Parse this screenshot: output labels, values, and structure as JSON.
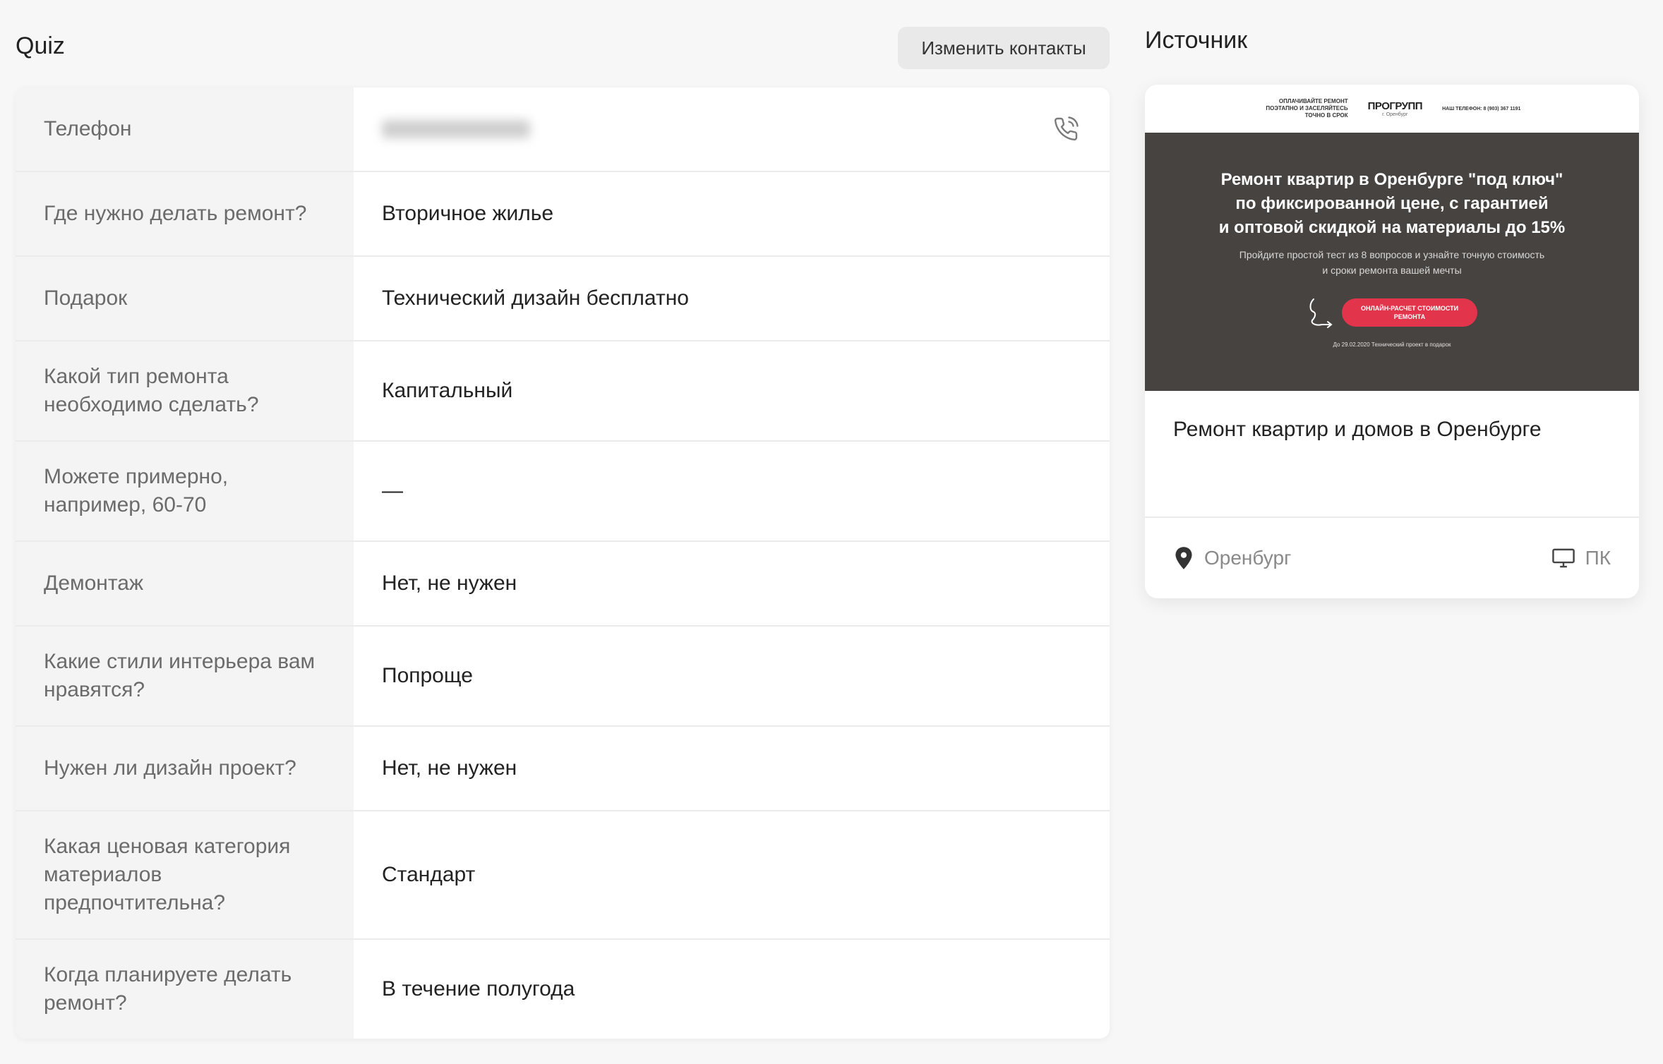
{
  "header": {
    "title": "Quiz",
    "edit_contacts_label": "Изменить контакты"
  },
  "quiz": {
    "phone_label": "Телефон",
    "rows": [
      {
        "question": "Где нужно делать ремонт?",
        "answer": "Вторичное жилье"
      },
      {
        "question": "Подарок",
        "answer": "Технический дизайн бесплатно"
      },
      {
        "question": "Какой тип ремонта необходимо сделать?",
        "answer": "Капитальный"
      },
      {
        "question": "Можете примерно, например, 60-70",
        "answer": "—"
      },
      {
        "question": "Демонтаж",
        "answer": "Нет, не нужен"
      },
      {
        "question": "Какие стили интерьера вам нравятся?",
        "answer": "Попроще"
      },
      {
        "question": "Нужен ли дизайн проект?",
        "answer": "Нет, не нужен"
      },
      {
        "question": "Какая ценовая категория материалов предпочтительна?",
        "answer": "Стандарт"
      },
      {
        "question": "Когда планируете делать ремонт?",
        "answer": "В течение полугода"
      }
    ]
  },
  "source": {
    "title": "Источник",
    "preview": {
      "top_left": "ОПЛАЧИВАЙТЕ РЕМОНТ ПОЭТАПНО И ЗАСЕЛЯЙТЕСЬ ТОЧНО В СРОК",
      "logo": "ПРОГРУПП",
      "logo_sub": "г. Оренбург",
      "phone": "НАШ ТЕЛЕФОН: 8 (903) 367 1191",
      "headline": "Ремонт квартир в Оренбурге \"под ключ\"\nпо фиксированной цене, с гарантией\nи оптовой скидкой на материалы до 15%",
      "subline": "Пройдите простой тест из 8 вопросов и узнайте точную стоимость\nи сроки ремонта вашей мечты",
      "cta": "ОНЛАЙН-РАСЧЕТ СТОИМОСТИ\nРЕМОНТА",
      "note": "До 29.02.2020 Технический проект в подарок"
    },
    "card_title": "Ремонт квартир и домов в Оренбурге",
    "city": "Оренбург",
    "device": "ПК"
  },
  "icons": {
    "phone": "phone-call-icon",
    "location": "location-pin-icon",
    "device": "monitor-icon"
  }
}
